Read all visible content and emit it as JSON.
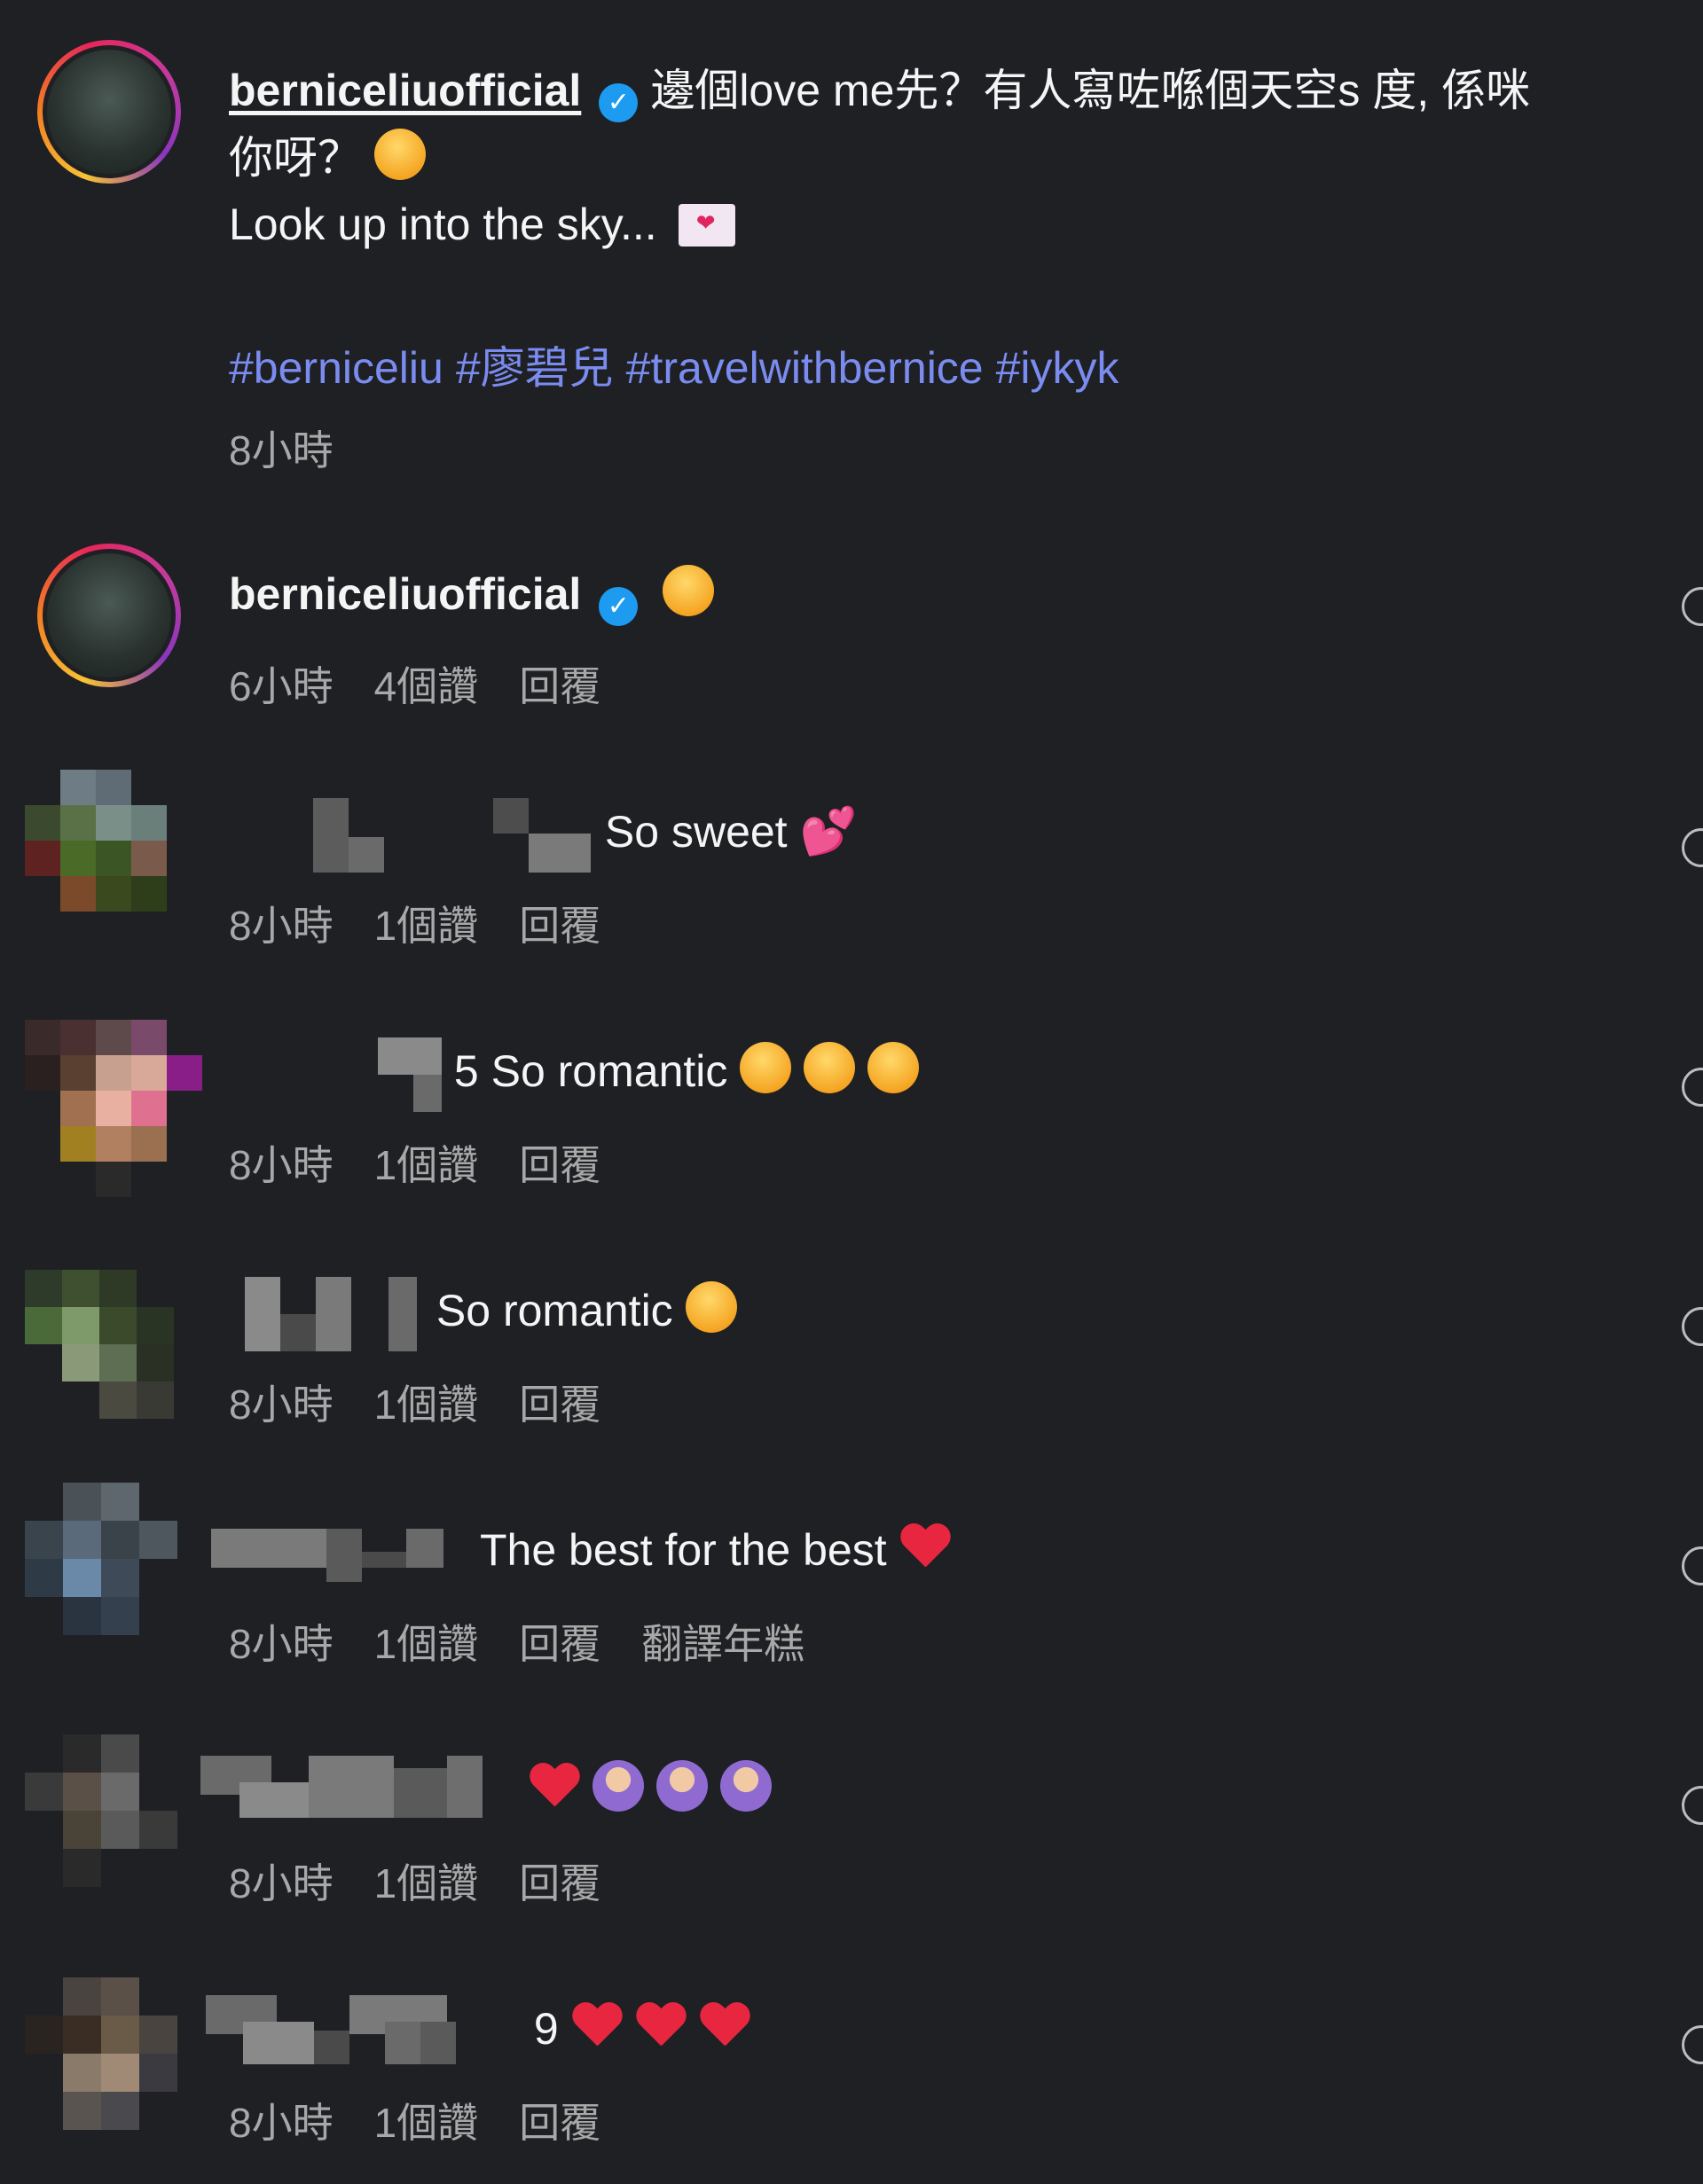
{
  "post": {
    "username": "berniceliuofficial",
    "caption_line1": "邊個love me先？有人寫咗喺個天空s 度, 係咪",
    "caption_line2": "你呀？",
    "caption_line3": "Look up into the sky...",
    "hashtags": [
      "#berniceliu",
      "#廖碧兒",
      "#travelwithbernice",
      "#iykyk"
    ],
    "time": "8小時"
  },
  "comments": [
    {
      "username": "berniceliuofficial",
      "time": "6小時",
      "likes": "4個讚",
      "reply": "回覆"
    },
    {
      "text": "So sweet",
      "time": "8小時",
      "likes": "1個讚",
      "reply": "回覆"
    },
    {
      "text": "5 So romantic",
      "time": "8小時",
      "likes": "1個讚",
      "reply": "回覆"
    },
    {
      "text": "So romantic",
      "time": "8小時",
      "likes": "1個讚",
      "reply": "回覆"
    },
    {
      "text": "The best for the best",
      "time": "8小時",
      "likes": "1個讚",
      "reply": "回覆",
      "translate": "翻譯年糕"
    },
    {
      "text": "",
      "time": "8小時",
      "likes": "1個讚",
      "reply": "回覆"
    },
    {
      "text": "9",
      "time": "8小時",
      "likes": "1個讚",
      "reply": "回覆"
    }
  ],
  "colors": {
    "background": "#1e2024",
    "hashtag": "#7b8cf0",
    "verified": "#1d9bf0",
    "meta": "#a8a8a8"
  },
  "icons": [
    "verified-badge-icon",
    "like-heart-icon",
    "heart-emoji",
    "heart-eyes-emoji",
    "laughing-emoji",
    "thinking-emoji",
    "envelope-heart-emoji",
    "two-hearts-emoji",
    "person-gesturing-ok-emoji"
  ]
}
